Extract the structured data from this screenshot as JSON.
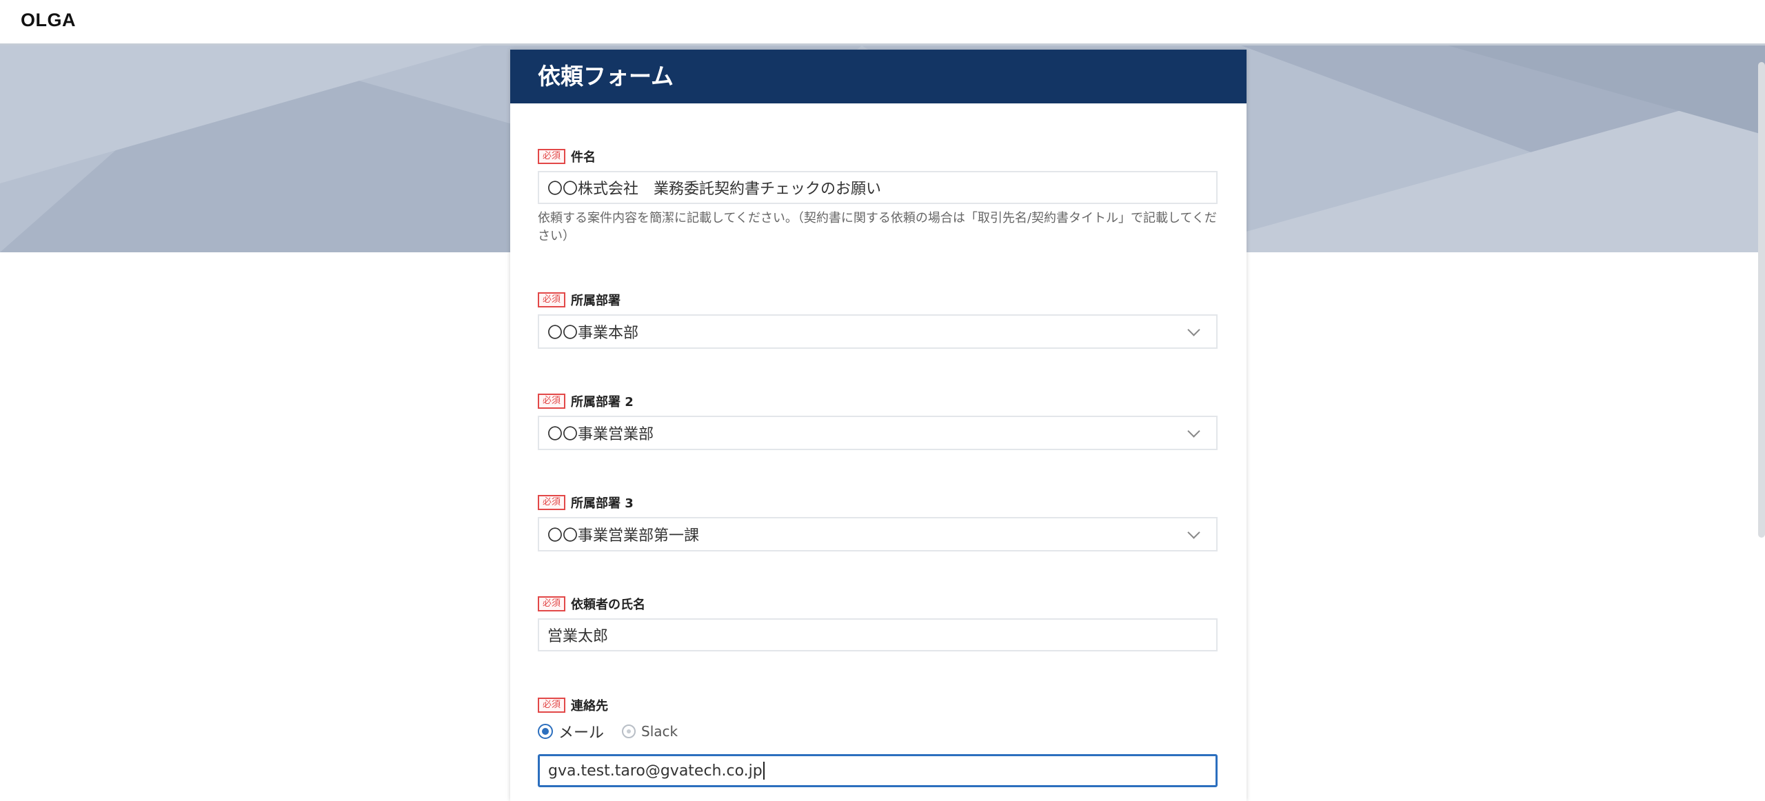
{
  "app": {
    "brand": "OLGA"
  },
  "form": {
    "title": "依頼フォーム",
    "required_badge": "必須",
    "fields": {
      "subject": {
        "label": "件名",
        "value": "〇〇株式会社　業務委託契約書チェックのお願い",
        "help": "依頼する案件内容を簡潔に記載してください。（契約書に関する依頼の場合は「取引先名/契約書タイトル」で記載してください）"
      },
      "department1": {
        "label": "所属部署",
        "value": "〇〇事業本部"
      },
      "department2": {
        "label": "所属部署 2",
        "value": "〇〇事業営業部"
      },
      "department3": {
        "label": "所属部署 3",
        "value": "〇〇事業営業部第一課"
      },
      "requester_name": {
        "label": "依頼者の氏名",
        "value": "営業太郎"
      },
      "contact": {
        "label": "連絡先",
        "options": [
          "メール",
          "Slack"
        ],
        "selected": "メール",
        "email_value": "gva.test.taro@gvatech.co.jp"
      }
    }
  },
  "colors": {
    "header_bg": "#133564",
    "hero_bg": "#b6c0d0",
    "required": "#e24848",
    "focus": "#2c6fbe"
  },
  "icons": {
    "select": "chevron-down-icon",
    "radio": "radio-icon"
  }
}
